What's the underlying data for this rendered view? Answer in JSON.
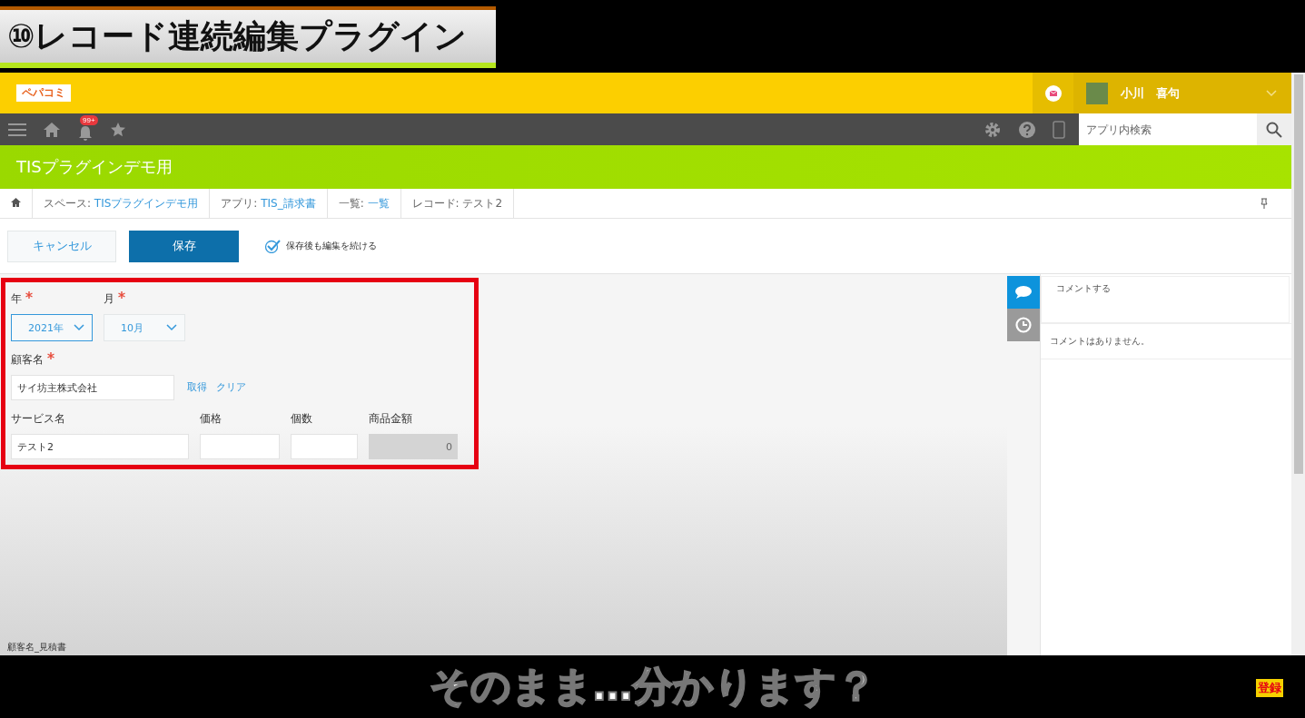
{
  "video_title": "⑩レコード連続編集プラグイン",
  "header": {
    "logo": "ペパコミ",
    "user_name": "小川　喜句"
  },
  "navbar": {
    "notification_count": "99+",
    "search": {
      "placeholder": "アプリ内検索"
    }
  },
  "app_title": "TISプラグインデモ用",
  "breadcrumbs": [
    {
      "label": "スペース: ",
      "link": "TISプラグインデモ用"
    },
    {
      "label": "アプリ: ",
      "link": "TIS_請求書"
    },
    {
      "label": "一覧: ",
      "link": "一覧"
    },
    {
      "label": "レコード: テスト2"
    }
  ],
  "toolbar": {
    "cancel": "キャンセル",
    "save": "保存",
    "keep_editing": {
      "label": "保存後も編集を続ける",
      "checked": true
    }
  },
  "form": {
    "highlighted": true,
    "rows": [
      [
        {
          "kind": "select",
          "label": "年",
          "required": true,
          "value": "2021年",
          "focused": true
        },
        {
          "kind": "select",
          "label": "月",
          "required": true,
          "value": "10月",
          "focused": false
        }
      ],
      [
        {
          "kind": "lookup",
          "label": "顧客名",
          "required": true,
          "value": "サイ坊主株式会社",
          "actions": [
            "取得",
            "クリア"
          ]
        }
      ],
      [
        {
          "kind": "text",
          "label": "サービス名",
          "required": false,
          "value": "テスト2"
        },
        {
          "kind": "text",
          "label": "価格",
          "required": false
        },
        {
          "kind": "text",
          "label": "個数",
          "required": false
        },
        {
          "kind": "calc",
          "label": "商品金額",
          "required": false,
          "value": "0"
        }
      ]
    ]
  },
  "footer_label": "顧客名_見積書",
  "comments": {
    "placeholder": "コメントする",
    "empty_text": "コメントはありません。",
    "tabs": [
      {
        "kind": "comments",
        "selected": true
      },
      {
        "kind": "history",
        "selected": false
      }
    ]
  },
  "caption": "そのまま…分かります？",
  "subscribe_badge": "登録"
}
